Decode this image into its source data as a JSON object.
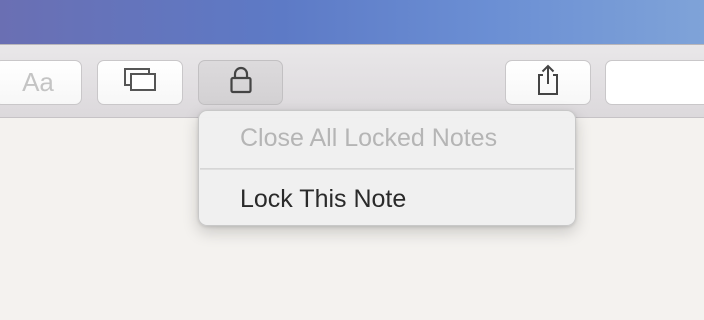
{
  "toolbar": {
    "font_button_label": "Aa",
    "icons": {
      "gallery": "gallery-view-icon",
      "lock": "lock-icon",
      "share": "share-icon"
    }
  },
  "lock_menu": {
    "items": [
      {
        "label": "Close All Locked Notes",
        "enabled": false
      },
      {
        "label": "Lock This Note",
        "enabled": true
      }
    ]
  },
  "colors": {
    "menu_background": "#f0f0f0",
    "disabled_text": "#b5b5b5",
    "enabled_text": "#2a2a2a",
    "toolbar_background": "#e2e0e2"
  }
}
